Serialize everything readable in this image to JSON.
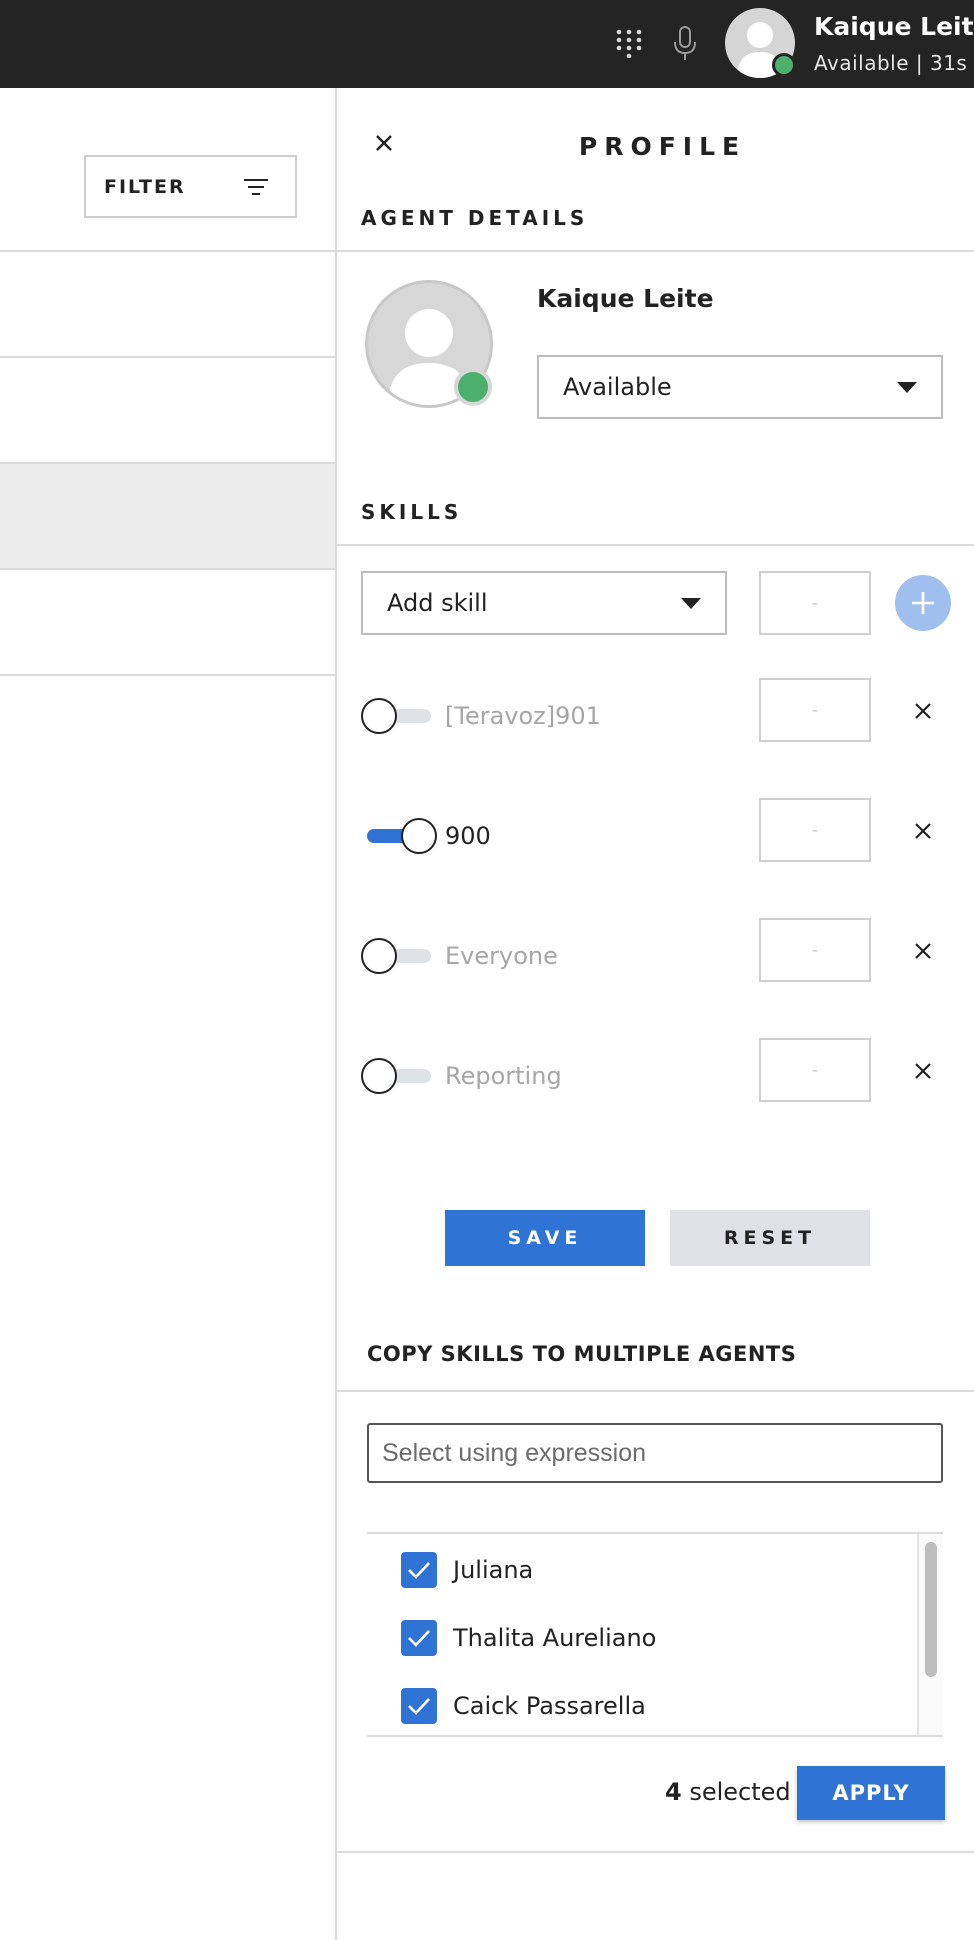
{
  "header": {
    "user_name": "Kaique Leite",
    "user_status": "Available | 31s",
    "status_color": "#4caf6e",
    "icons": [
      "dialpad-icon",
      "microphone-icon",
      "avatar"
    ]
  },
  "left_pane": {
    "filter_label": "FILTER",
    "filter_icon": "filter-lines-icon"
  },
  "profile": {
    "title": "PROFILE",
    "close_icon": "close-icon",
    "agent_details_heading": "AGENT DETAILS",
    "agent_name": "Kaique Leite",
    "status_select": {
      "value": "Available"
    },
    "skills_heading": "SKILLS",
    "add_skill": {
      "value": "Add skill",
      "level_placeholder": "-"
    },
    "skills": [
      {
        "name": "[Teravoz]901",
        "enabled": false,
        "level": "-"
      },
      {
        "name": "900",
        "enabled": true,
        "level": "-"
      },
      {
        "name": "Everyone",
        "enabled": false,
        "level": "-"
      },
      {
        "name": "Reporting",
        "enabled": false,
        "level": "-"
      }
    ],
    "save_label": "SAVE",
    "reset_label": "RESET"
  },
  "copy_skills": {
    "title": "COPY SKILLS TO MULTIPLE AGENTS",
    "expression_placeholder": "Select using expression",
    "agents": [
      {
        "name": "Juliana",
        "checked": true
      },
      {
        "name": "Thalita Aureliano",
        "checked": true
      },
      {
        "name": "Caick Passarella",
        "checked": true
      }
    ],
    "selected_count": "4",
    "selected_label": "selected",
    "apply_label": "APPLY"
  },
  "colors": {
    "primary": "#2f73d4",
    "topbar": "#242424",
    "online": "#4caf6e"
  }
}
